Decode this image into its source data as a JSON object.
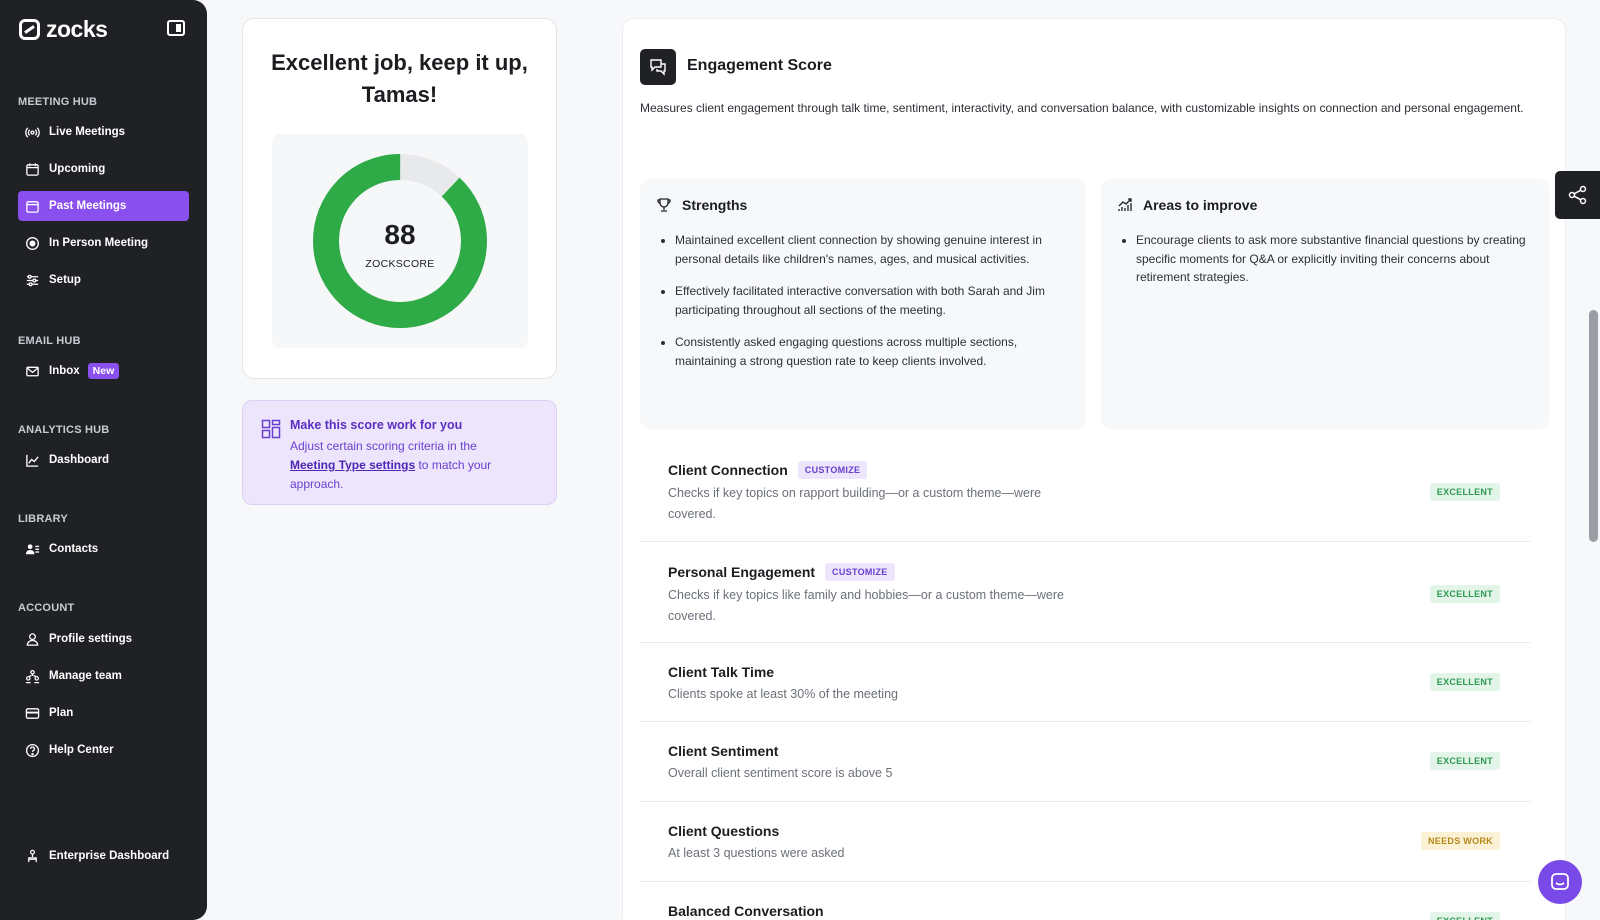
{
  "app": {
    "name": "zocks"
  },
  "sidebar": {
    "sections": {
      "meeting_hub": "MEETING HUB",
      "email_hub": "EMAIL HUB",
      "analytics_hub": "ANALYTICS HUB",
      "library": "LIBRARY",
      "account": "ACCOUNT"
    },
    "items": {
      "live_meetings": "Live Meetings",
      "upcoming": "Upcoming",
      "past_meetings": "Past Meetings",
      "in_person": "In Person Meeting",
      "setup": "Setup",
      "inbox": "Inbox",
      "inbox_badge": "New",
      "dashboard": "Dashboard",
      "contacts": "Contacts",
      "profile_settings": "Profile settings",
      "manage_team": "Manage team",
      "plan": "Plan",
      "help_center": "Help Center",
      "enterprise_dashboard": "Enterprise Dashboard"
    },
    "active_item": "Past Meetings",
    "accent_color": "#8a4fef"
  },
  "score": {
    "title": "Excellent job, keep it up, Tamas!",
    "value": "88",
    "fraction": 0.88,
    "label": "ZOCKSCORE",
    "ring_color": "#2eaa46"
  },
  "tip": {
    "title": "Make this score work for you",
    "body_prefix": "Adjust certain scoring criteria in the ",
    "link": "Meeting Type settings",
    "body_suffix": " to match your approach."
  },
  "engagement": {
    "title": "Engagement Score",
    "description": "Measures client engagement through talk time, sentiment, interactivity, and conversation balance, with customizable insights on connection and personal engagement.",
    "strengths": {
      "title": "Strengths",
      "items": [
        "Maintained excellent client connection by showing genuine interest in personal details like children's names, ages, and musical activities.",
        "Effectively facilitated interactive conversation with both Sarah and Jim participating throughout all sections of the meeting.",
        "Consistently asked engaging questions across multiple sections, maintaining a strong question rate to keep clients involved."
      ]
    },
    "improve": {
      "title": "Areas to improve",
      "items": [
        "Encourage clients to ask more substantive financial questions by creating specific moments for Q&A or explicitly inviting their concerns about retirement strategies."
      ]
    },
    "criteria": [
      {
        "name": "Client Connection",
        "customize": "CUSTOMIZE",
        "desc": "Checks if key topics on rapport building—or a custom theme—were covered.",
        "status": "EXCELLENT"
      },
      {
        "name": "Personal Engagement",
        "customize": "CUSTOMIZE",
        "desc": "Checks if key topics like family and hobbies—or a custom theme—were covered.",
        "status": "EXCELLENT"
      },
      {
        "name": "Client Talk Time",
        "customize": "",
        "desc": "Clients spoke at least 30% of the meeting",
        "status": "EXCELLENT"
      },
      {
        "name": "Client Sentiment",
        "customize": "",
        "desc": "Overall client sentiment score is above 5",
        "status": "EXCELLENT"
      },
      {
        "name": "Client Questions",
        "customize": "",
        "desc": "At least 3 questions were asked",
        "status": "NEEDS WORK"
      },
      {
        "name": "Balanced Conversation",
        "customize": "",
        "desc": "",
        "status": "EXCELLENT"
      }
    ]
  }
}
